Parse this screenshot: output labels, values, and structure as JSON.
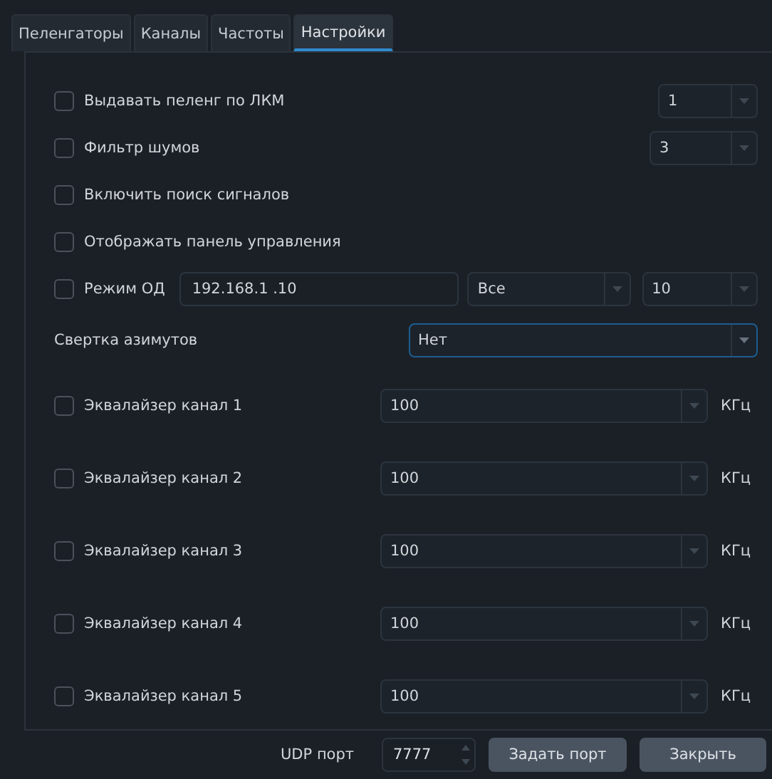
{
  "tabs": [
    {
      "label": "Пеленгаторы",
      "selected": false
    },
    {
      "label": "Каналы",
      "selected": false
    },
    {
      "label": "Частоты",
      "selected": false
    },
    {
      "label": "Настройки",
      "selected": true
    }
  ],
  "settings": [
    {
      "kind": "check_combo",
      "label": "Выдавать пеленг по ЛКМ",
      "checked": false,
      "value": "1"
    },
    {
      "kind": "check_combo",
      "label": "Фильтр шумов",
      "checked": false,
      "value": "3"
    },
    {
      "kind": "check",
      "label": "Включить поиск сигналов",
      "checked": false
    },
    {
      "kind": "check",
      "label": "Отображать панель управления",
      "checked": false
    },
    {
      "kind": "od",
      "label": "Режим ОД",
      "checked": false,
      "ip": "192.168.1 .10",
      "mode": "Все",
      "count": "10"
    },
    {
      "kind": "combo",
      "label": "Свертка азимутов",
      "value": "Нет"
    }
  ],
  "equalizers": [
    {
      "label": "Эквалайзер канал 1",
      "checked": false,
      "value": "100",
      "unit": "КГц"
    },
    {
      "label": "Эквалайзер канал 2",
      "checked": false,
      "value": "100",
      "unit": "КГц"
    },
    {
      "label": "Эквалайзер канал 3",
      "checked": false,
      "value": "100",
      "unit": "КГц"
    },
    {
      "label": "Эквалайзер канал 4",
      "checked": false,
      "value": "100",
      "unit": "КГц"
    },
    {
      "label": "Эквалайзер канал 5",
      "checked": false,
      "value": "100",
      "unit": "КГц"
    }
  ],
  "footer": {
    "port_label": "UDP порт",
    "port": "7777",
    "buttons": [
      "Задать порт",
      "Закрыть"
    ]
  }
}
